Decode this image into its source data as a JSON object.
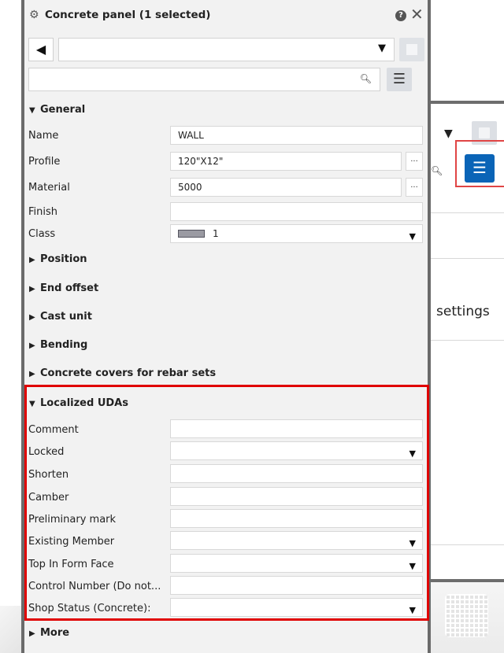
{
  "panel": {
    "title": "Concrete panel (1 selected)",
    "help_label": "?",
    "close_label": "✕",
    "preset_value": "",
    "search_value": ""
  },
  "sections": {
    "general": "General",
    "position": "Position",
    "end_offset": "End offset",
    "cast_unit": "Cast unit",
    "bending": "Bending",
    "concrete_covers": "Concrete covers for rebar sets",
    "localized_udas": "Localized UDAs",
    "more": "More"
  },
  "general": {
    "name_label": "Name",
    "name_value": "WALL",
    "profile_label": "Profile",
    "profile_value": "120\"X12\"",
    "material_label": "Material",
    "material_value": "5000",
    "finish_label": "Finish",
    "finish_value": "",
    "class_label": "Class",
    "class_value": "1",
    "ellipsis": "..."
  },
  "udas": {
    "comment": "Comment",
    "locked": "Locked",
    "shorten": "Shorten",
    "camber": "Camber",
    "preliminary_mark": "Preliminary mark",
    "existing_member": "Existing Member",
    "top_in_form_face": "Top In Form Face",
    "control_number": "Control Number (Do not...",
    "shop_status": "Shop Status (Concrete):"
  },
  "background": {
    "settings_text": "settings"
  },
  "colors": {
    "accent": "#0a64b7",
    "highlight": "#e00000",
    "panel_bg": "#f2f2f2"
  },
  "icons": {
    "gear": "gear-icon",
    "help": "help-icon",
    "close": "close-icon",
    "back": "back-arrow-icon",
    "save": "save-icon",
    "search": "search-icon",
    "menu": "menu-icon",
    "dropdown": "chevron-down-icon"
  }
}
